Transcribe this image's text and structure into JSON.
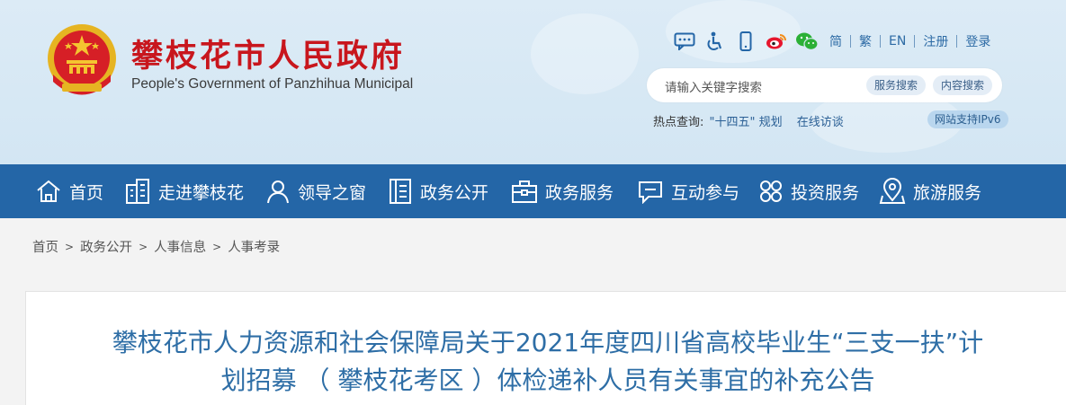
{
  "header": {
    "site_name": "攀枝花市人民政府",
    "site_name_en": "People's Government of Panzhihua Municipal",
    "tools": {
      "icons": [
        "chat-icon",
        "accessibility-icon",
        "mobile-icon",
        "weibo-icon",
        "wechat-icon"
      ],
      "links": [
        "简",
        "繁",
        "EN",
        "注册",
        "登录"
      ]
    },
    "search": {
      "placeholder": "请输入关键字搜索",
      "service_search": "服务搜索",
      "content_search": "内容搜索"
    },
    "hot": {
      "label": "热点查询:",
      "keyword1": "\"十四五\" 规划",
      "keyword2": "在线访谈"
    },
    "ipv6": "网站支持IPv6"
  },
  "nav": {
    "items": [
      {
        "label": "首页",
        "icon": "home-icon"
      },
      {
        "label": "走进攀枝花",
        "icon": "building-icon"
      },
      {
        "label": "领导之窗",
        "icon": "person-icon"
      },
      {
        "label": "政务公开",
        "icon": "document-icon"
      },
      {
        "label": "政务服务",
        "icon": "briefcase-icon"
      },
      {
        "label": "互动参与",
        "icon": "chat-bubble-icon"
      },
      {
        "label": "投资服务",
        "icon": "grid-icon"
      },
      {
        "label": "旅游服务",
        "icon": "map-pin-icon"
      }
    ]
  },
  "breadcrumb": [
    "首页",
    "政务公开",
    "人事信息",
    "人事考录"
  ],
  "article": {
    "title_line1": "攀枝花市人力资源和社会保障局关于2021年度四川省高校毕业生“三支一扶”计",
    "title_line2": "划招募 （ 攀枝花考区 ）体检递补人员有关事宜的补充公告"
  },
  "colors": {
    "brand_red": "#c8161d",
    "nav_blue": "#2466a7",
    "title_blue": "#2e6ea6",
    "header_bg": "#d8e9f5"
  }
}
